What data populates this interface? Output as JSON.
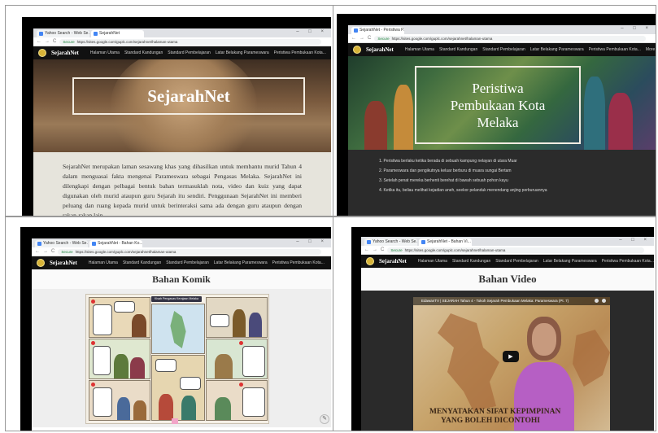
{
  "browser": {
    "window_controls": "– □ ×",
    "nav_buttons": {
      "back": "←",
      "forward": "→",
      "reload": "C"
    },
    "secure_label": "Secure",
    "url_text": "https://sites.google.com/guplc.com/sejarahnet/halaman-utama"
  },
  "site": {
    "brand": "SejarahNet",
    "nav_items": [
      "Halaman Utama",
      "Standard Kandungan",
      "Standard Pembelajaran",
      "Latar Belakang Parameswara",
      "Peristiwa Pembukaan Kota..."
    ]
  },
  "screens": {
    "home": {
      "tabs": [
        "Yahoo Search - Web Se...",
        "SejarahNet"
      ],
      "hero_title": "SejarahNet",
      "intro": "SejarahNet merupakan laman sesawang khas yang dihasilkan untuk membantu murid Tahun 4 dalam menguasai fakta mengenai Parameswara sebagai Pengasas Melaka. SejarahNet ini dilengkapi dengan pelbagai bentuk bahan termasuklah nota, video dan kuiz yang dapat digunakan oleh murid ataupun guru Sejarah itu sendiri. Penggunaan SejarahNet ini memberi peluang dan ruang kepada murid untuk berinteraksi sama ada dengan guru ataupun dengan rakan-rakan lain."
    },
    "event": {
      "tabs": [
        "SejarahNet - Peristiwa P..."
      ],
      "nav_extra": "More",
      "hero_title_lines": [
        "Peristiwa",
        "Pembukaan Kota",
        "Melaka"
      ],
      "list": [
        "1. Peristiwa berlaku ketika berada di sebuah kampung nelayan di utara Muar",
        "2. Parameswara dan pengikutnya keluar berburu di muara sungai Bertam",
        "3. Setelah penat mereka berhenti berehat di bawah sebuah pohon kayu",
        "4. Ketika itu, beliau melihat kejadian aneh, seekor pelanduk menendang anjing perburuannya"
      ]
    },
    "comic": {
      "tabs": [
        "Yahoo Search - Web Se...",
        "SejarahNet - Bahan Ko..."
      ],
      "heading": "Bahan Komik",
      "comic_title": "Kisah Pengasas Kerajaan Melaka"
    },
    "video": {
      "tabs": [
        "Yahoo Search - Web Se...",
        "SejarahNet - Bahan Vi..."
      ],
      "heading": "Bahan Video",
      "video_title": "EdawanTV | SEJARAH Tahun 4 - Tokoh Sejarah Pembukaan Melaka: Parameswara (Pt. 7)",
      "play_symbol": "▶",
      "caption_line1": "MENYATAKAN SIFAT KEPIMPINAN",
      "caption_line2": "YANG BOLEH DICONTOHI"
    }
  },
  "colors": {
    "nav_bg": "#111111",
    "video_bg": "#2a2a2a",
    "presenter_top": "#b65fc4"
  }
}
